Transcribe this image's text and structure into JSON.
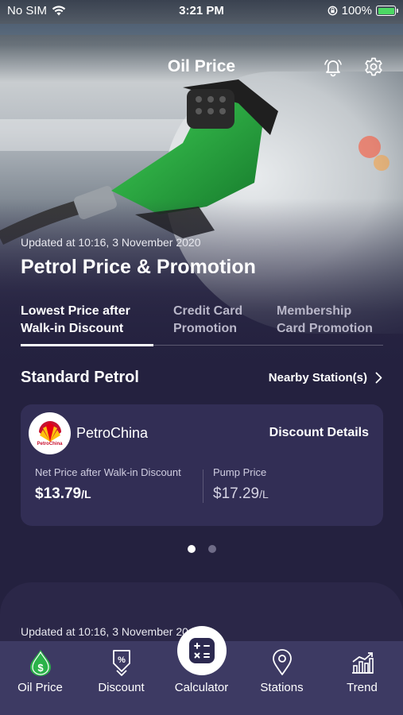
{
  "status_bar": {
    "carrier": "No SIM",
    "time": "3:21 PM",
    "battery": "100%"
  },
  "header": {
    "title": "Oil Price"
  },
  "hero": {
    "updated": "Updated at 10:16, 3 November 2020",
    "headline": "Petrol Price & Promotion"
  },
  "tabs": [
    {
      "label_line1": "Lowest Price after",
      "label_line2": "Walk-in Discount"
    },
    {
      "label_line1": "Credit Card",
      "label_line2": "Promotion"
    },
    {
      "label_line1": "Membership",
      "label_line2": "Card Promotion"
    }
  ],
  "section": {
    "title": "Standard Petrol",
    "nearby": "Nearby Station(s)"
  },
  "card": {
    "brand": "PetroChina",
    "logo_text": "PetroChina",
    "discount_link": "Discount Details",
    "net_label": "Net Price after Walk-in Discount",
    "net_value": "$13.79",
    "net_unit": "/L",
    "pump_label": "Pump Price",
    "pump_value": "$17.29",
    "pump_unit": "/L"
  },
  "pagination": {
    "total": 2,
    "current": 1
  },
  "next_panel": {
    "updated": "Updated at 10:16, 3 November 20"
  },
  "nav": [
    {
      "label": "Oil Price",
      "icon": "oil-drop-icon"
    },
    {
      "label": "Discount",
      "icon": "discount-tag-icon"
    },
    {
      "label": "Calculator",
      "icon": "calculator-icon"
    },
    {
      "label": "Stations",
      "icon": "location-pin-icon"
    },
    {
      "label": "Trend",
      "icon": "trend-chart-icon"
    }
  ],
  "colors": {
    "background": "#24213f",
    "card": "#322e55",
    "navbar": "#3d3a63",
    "accent_green": "#2bb34a",
    "battery": "#4cd964"
  }
}
